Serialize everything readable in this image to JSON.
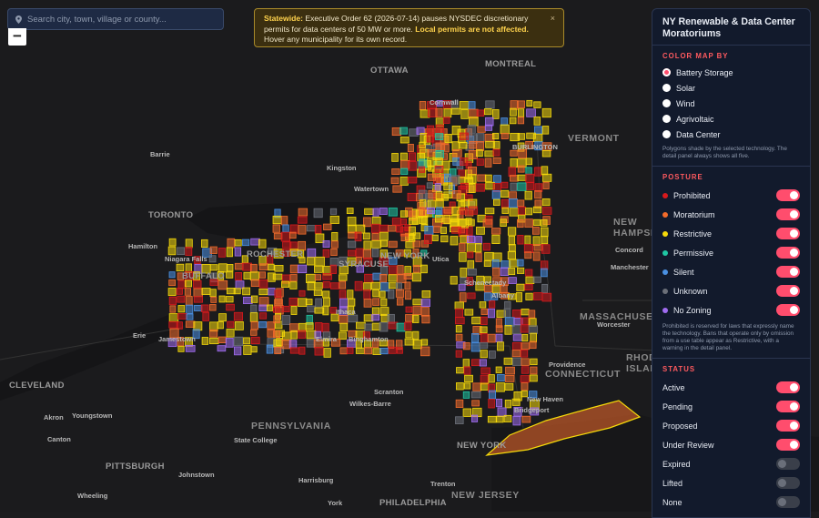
{
  "search": {
    "placeholder": "Search city, town, village or county..."
  },
  "zoom": {
    "out_label": "−"
  },
  "banner": {
    "lead": "Statewide:",
    "text1": " Executive Order 62 (2026-07-14) pauses NYSDEC discretionary permits for data centers of 50 MW or more. ",
    "bold2": "Local permits are not affected.",
    "text2": " Hover any municipality for its own record.",
    "close": "×"
  },
  "panel": {
    "title": "NY Renewable & Data Center Moratoriums",
    "color_by": {
      "heading": "COLOR MAP BY",
      "options": [
        "Battery Storage",
        "Solar",
        "Wind",
        "Agrivoltaic",
        "Data Center"
      ],
      "selected": "Battery Storage",
      "note": "Polygons shade by the selected technology. The detail panel always shows all five."
    },
    "posture": {
      "heading": "POSTURE",
      "items": [
        {
          "label": "Prohibited",
          "color": "#d7191c",
          "on": true
        },
        {
          "label": "Moratorium",
          "color": "#f26b2b",
          "on": true
        },
        {
          "label": "Restrictive",
          "color": "#f5d90a",
          "on": true
        },
        {
          "label": "Permissive",
          "color": "#1fc7a4",
          "on": true
        },
        {
          "label": "Silent",
          "color": "#4a90e2",
          "on": true
        },
        {
          "label": "Unknown",
          "color": "#6b6f78",
          "on": true
        },
        {
          "label": "No Zoning",
          "color": "#a06cf0",
          "on": true
        }
      ],
      "note": "Prohibited is reserved for laws that expressly name the technology. Bans that operate only by omission from a use table appear as Restrictive, with a warning in the detail panel."
    },
    "status": {
      "heading": "STATUS",
      "items": [
        {
          "label": "Active",
          "on": true
        },
        {
          "label": "Pending",
          "on": true
        },
        {
          "label": "Proposed",
          "on": true
        },
        {
          "label": "Under Review",
          "on": true
        },
        {
          "label": "Expired",
          "on": false
        },
        {
          "label": "Lifted",
          "on": false
        },
        {
          "label": "None",
          "on": false
        }
      ]
    }
  },
  "map_labels": {
    "cities": [
      "OTTAWA",
      "MONTREAL",
      "Cornwall",
      "BURLINGTON",
      "VERMONT",
      "Barrie",
      "Kingston",
      "Watertown",
      "TORONTO",
      "Hamilton",
      "Niagara Falls",
      "BUFFALO",
      "ROCHESTER",
      "SYRACUSE",
      "NEW YORK",
      "Utica",
      "Schenectady",
      "Albany",
      "Ithaca",
      "Elmira",
      "Binghamton",
      "Jamestown",
      "Erie",
      "NEW HAMPSHIRE",
      "Concord",
      "Manchester",
      "MASSACHUSETTS",
      "Worcester",
      "RHODE ISLAND",
      "Providence",
      "CONNECTICUT",
      "CLEVELAND",
      "Akron",
      "Youngstown",
      "Canton",
      "Scranton",
      "Wilkes-Barre",
      "New Haven",
      "Bridgeport",
      "PENNSYLVANIA",
      "State College",
      "PITTSBURGH",
      "Johnstown",
      "Harrisburg",
      "Trenton",
      "NEW JERSEY",
      "Wheeling",
      "York",
      "PHILADELPHIA"
    ]
  }
}
